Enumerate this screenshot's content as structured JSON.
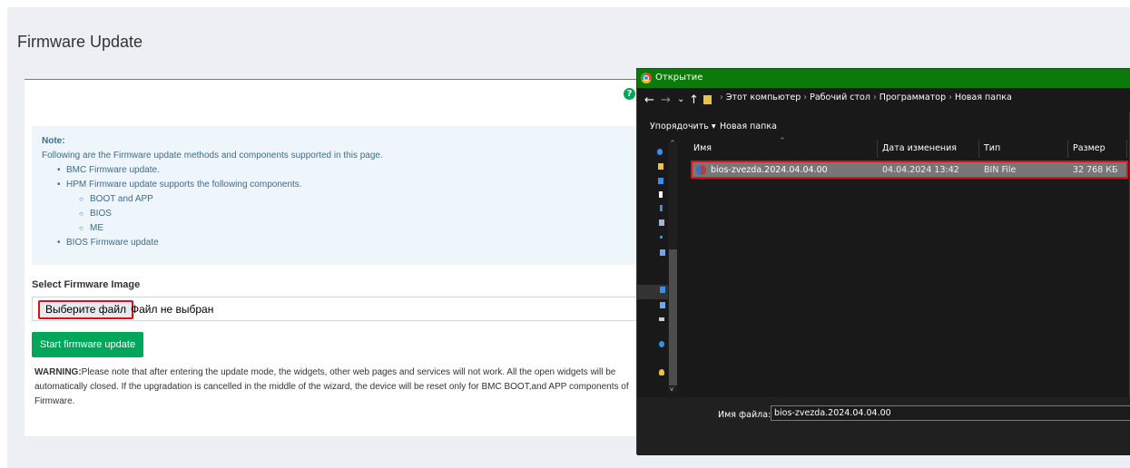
{
  "page": {
    "title": "Firmware Update",
    "help_icon": "question-circle-icon",
    "note": {
      "title": "Note:",
      "intro": "Following are the Firmware update methods and components supported in this page.",
      "items": [
        "BMC Firmware update.",
        "HPM Firmware update supports the following components.",
        "BIOS Firmware update"
      ],
      "subitems": [
        "BOOT and APP",
        "BIOS",
        "ME"
      ]
    },
    "select_label": "Select Firmware Image",
    "choose_file_label": "Выберите файл",
    "file_status": "Файл не выбран",
    "start_button": "Start firmware update",
    "warning_title": "WARNING:",
    "warning_text": "Please note that after entering the update mode, the widgets, other web pages and services will not work. All the open widgets will be automatically closed. If the upgradation is cancelled in the middle of the wizard, the device will be reset only for BMC BOOT,and APP components of Firmware.",
    "accent_color": "#3c8dbc",
    "button_color": "#00a65a",
    "highlight_color": "#e0101a"
  },
  "dialog": {
    "title": "Открытие",
    "icon": "chrome-icon",
    "nav": {
      "back": "←",
      "forward": "→",
      "recent": "⌄",
      "up": "↑"
    },
    "breadcrumb": [
      "Этот компьютер",
      "Рабочий стол",
      "Программатор",
      "Новая папка"
    ],
    "toolbar": {
      "organize": "Упорядочить ▾",
      "new_folder": "Новая папка"
    },
    "columns": {
      "name": "Имя",
      "date": "Дата изменения",
      "type": "Тип",
      "size": "Размер"
    },
    "file": {
      "name": "bios-zvezda.2024.04.04.00",
      "date": "04.04.2024 13:42",
      "type": "BIN File",
      "size": "32 768 КБ"
    },
    "filename_label": "Имя файла:",
    "filename_value": "bios-zvezda.2024.04.04.00",
    "titlebar_color": "#0b7a0b"
  }
}
